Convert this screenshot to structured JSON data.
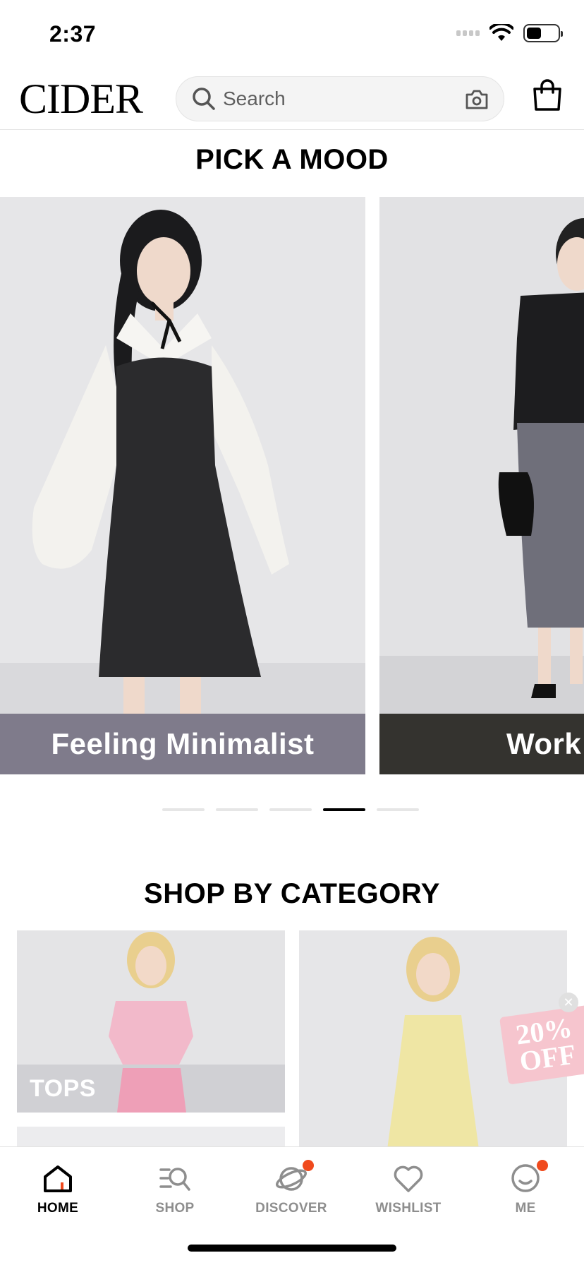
{
  "status_bar": {
    "time": "2:37",
    "battery_level": 0.45
  },
  "header": {
    "logo": "CIDER",
    "search": {
      "placeholder": "Search"
    },
    "icons": [
      "search-icon",
      "camera-icon",
      "shopping-bag-icon"
    ]
  },
  "mood": {
    "title": "PICK A MOOD",
    "cards": [
      {
        "label": "Feeling Minimalist",
        "label_color": "#7f7b8b"
      },
      {
        "label": "Work W",
        "label_color": "#34332f"
      }
    ],
    "pagination": {
      "count": 5,
      "active_index": 3
    }
  },
  "category": {
    "title": "SHOP BY CATEGORY",
    "items": [
      {
        "label": "TOPS"
      }
    ],
    "promo": {
      "line1": "20%",
      "line2": "OFF"
    }
  },
  "tabbar": {
    "tabs": [
      {
        "label": "HOME",
        "icon": "home-icon",
        "active": true,
        "badge": false
      },
      {
        "label": "SHOP",
        "icon": "shop-search-icon",
        "active": false,
        "badge": false
      },
      {
        "label": "DISCOVER",
        "icon": "planet-icon",
        "active": false,
        "badge": true
      },
      {
        "label": "WISHLIST",
        "icon": "heart-icon",
        "active": false,
        "badge": false
      },
      {
        "label": "ME",
        "icon": "smiley-icon",
        "active": false,
        "badge": true
      }
    ],
    "accent": "#f04a1d"
  }
}
